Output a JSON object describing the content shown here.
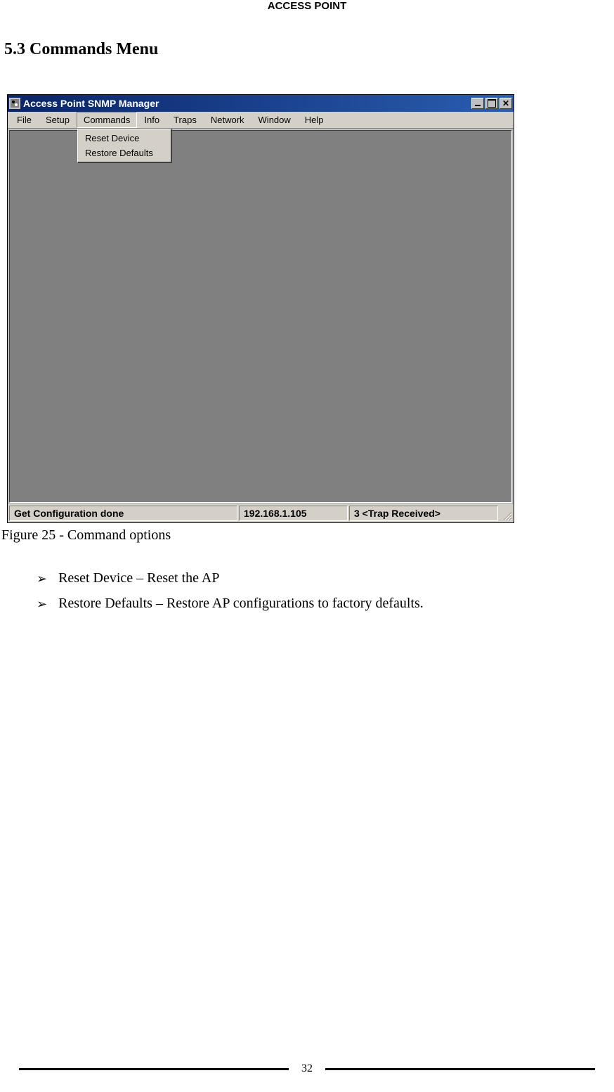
{
  "header": {
    "title": "ACCESS POINT"
  },
  "section": {
    "heading": "5.3 Commands Menu"
  },
  "window": {
    "title": "Access Point SNMP Manager",
    "menubar": {
      "items": [
        {
          "label": "File"
        },
        {
          "label": "Setup"
        },
        {
          "label": "Commands"
        },
        {
          "label": "Info"
        },
        {
          "label": "Traps"
        },
        {
          "label": "Network"
        },
        {
          "label": "Window"
        },
        {
          "label": "Help"
        }
      ]
    },
    "dropdown": {
      "items": [
        {
          "label": "Reset Device"
        },
        {
          "label": "Restore Defaults"
        }
      ]
    },
    "statusbar": {
      "status": "Get Configuration done",
      "ip": "192.168.1.105",
      "trap": "3 <Trap Received>"
    }
  },
  "caption": "Figure 25 - Command options",
  "bullets": [
    "Reset Device – Reset the AP",
    "Restore Defaults – Restore AP configurations to factory defaults."
  ],
  "page_number": "32"
}
